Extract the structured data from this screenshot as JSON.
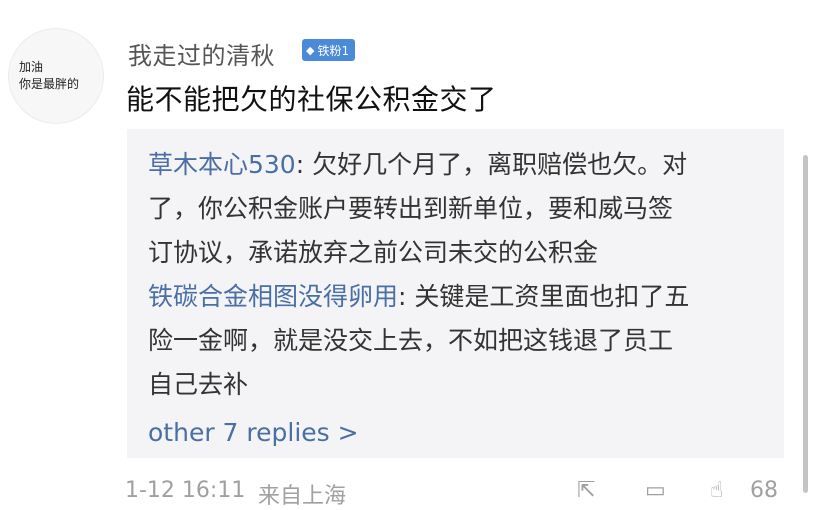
{
  "comment": {
    "avatar_text": [
      "加油",
      "你是最胖的"
    ],
    "username": "我走过的清秋",
    "badge": "铁粉1",
    "content": "能不能把欠的社保公积金交了"
  },
  "replies": [
    {
      "author": "草木本心530",
      "lines": [
        "欠好几个月了，离职赔偿也欠。对",
        "了，你公积金账户要转出到新单位，要和威马签",
        "订协议，承诺放弃之前公司未交的公积金"
      ]
    },
    {
      "author": "铁碳合金相图没得卵用",
      "lines": [
        "关键是工资里面也扣了五",
        "险一金啊，就是没交上去，不如把这钱退了员工",
        "自己去补"
      ]
    }
  ],
  "more_replies": "other 7 replies >",
  "footer": {
    "timestamp": "1-12 16:11",
    "location": "来自上海",
    "like_count": "68"
  },
  "icons": [
    "diamond-icon",
    "share-icon",
    "comment-icon",
    "like-icon"
  ],
  "colors": {
    "link": "#4a6fa5",
    "badge": "#4a8ad9",
    "reply_bg": "#f4f4f6"
  }
}
